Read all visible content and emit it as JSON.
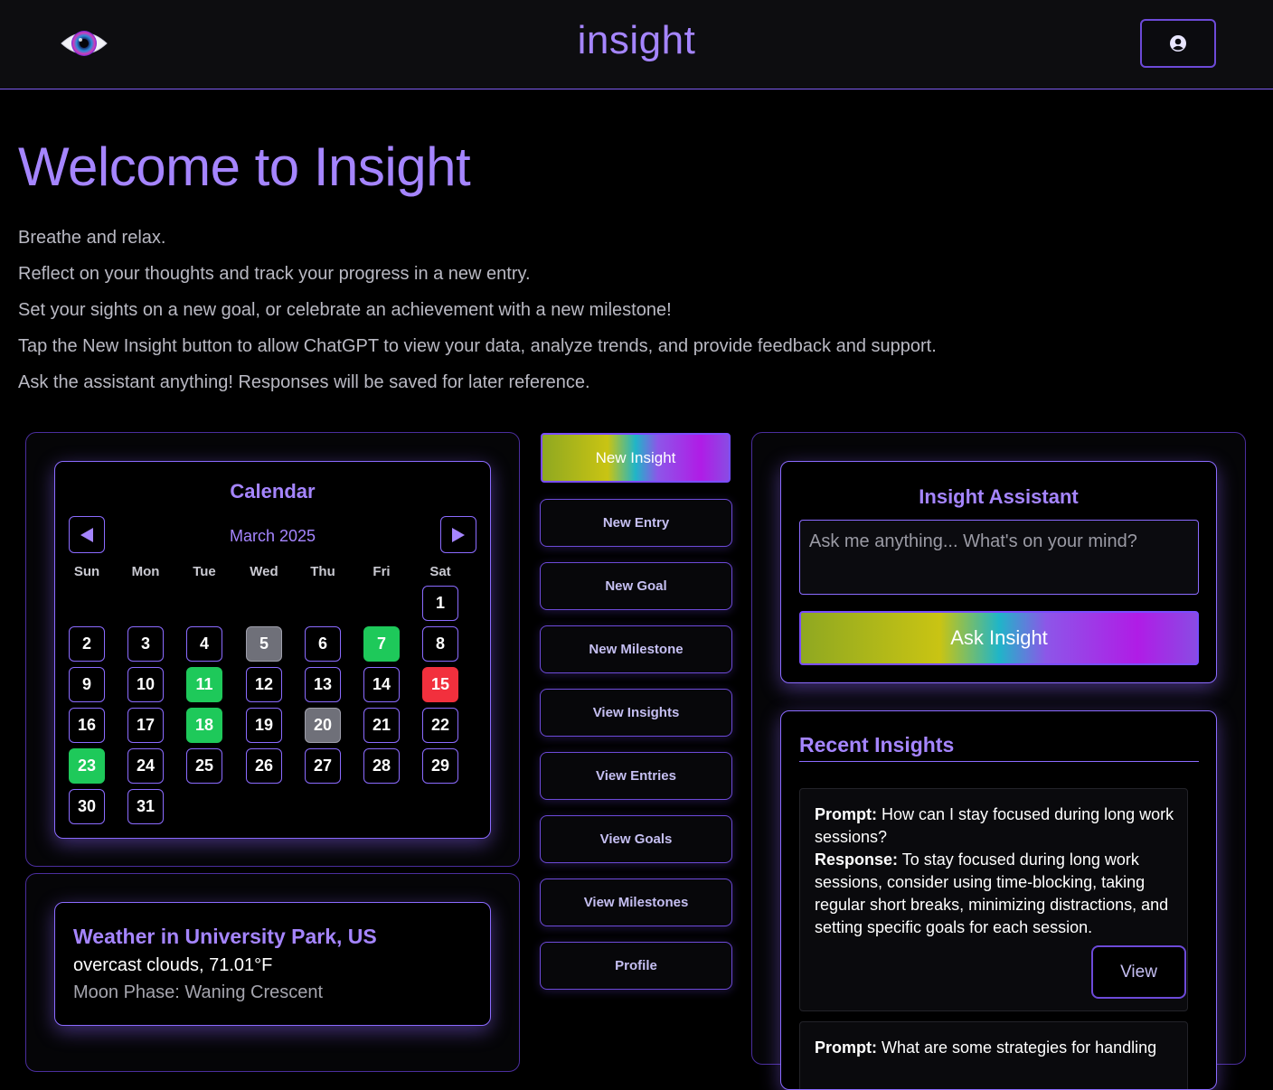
{
  "header": {
    "brand": "insight",
    "logo_icon": "eye-logo-icon",
    "profile_icon": "user-circle-icon"
  },
  "intro": {
    "title": "Welcome to Insight",
    "lines": [
      "Breathe and relax.",
      "Reflect on your thoughts and track your progress in a new entry.",
      "Set your sights on a new goal, or celebrate an achievement with a new milestone!",
      "Tap the New Insight button to allow ChatGPT to view your data, analyze trends, and provide feedback and support.",
      "Ask the assistant anything! Responses will be saved for later reference."
    ]
  },
  "calendar": {
    "title": "Calendar",
    "month": "March 2025",
    "prev_icon": "triangle-left-icon",
    "next_icon": "triangle-right-icon",
    "weekdays": [
      "Sun",
      "Mon",
      "Tue",
      "Wed",
      "Thu",
      "Fri",
      "Sat"
    ],
    "first_weekday_index": 6,
    "days": [
      {
        "n": "1",
        "status": "none"
      },
      {
        "n": "2",
        "status": "none"
      },
      {
        "n": "3",
        "status": "none"
      },
      {
        "n": "4",
        "status": "none"
      },
      {
        "n": "5",
        "status": "gray"
      },
      {
        "n": "6",
        "status": "none"
      },
      {
        "n": "7",
        "status": "green"
      },
      {
        "n": "8",
        "status": "none"
      },
      {
        "n": "9",
        "status": "none"
      },
      {
        "n": "10",
        "status": "none"
      },
      {
        "n": "11",
        "status": "green"
      },
      {
        "n": "12",
        "status": "none"
      },
      {
        "n": "13",
        "status": "none"
      },
      {
        "n": "14",
        "status": "none"
      },
      {
        "n": "15",
        "status": "red"
      },
      {
        "n": "16",
        "status": "none"
      },
      {
        "n": "17",
        "status": "none"
      },
      {
        "n": "18",
        "status": "green"
      },
      {
        "n": "19",
        "status": "none"
      },
      {
        "n": "20",
        "status": "gray"
      },
      {
        "n": "21",
        "status": "none"
      },
      {
        "n": "22",
        "status": "none"
      },
      {
        "n": "23",
        "status": "green"
      },
      {
        "n": "24",
        "status": "none"
      },
      {
        "n": "25",
        "status": "none"
      },
      {
        "n": "26",
        "status": "none"
      },
      {
        "n": "27",
        "status": "none"
      },
      {
        "n": "28",
        "status": "none"
      },
      {
        "n": "29",
        "status": "none"
      },
      {
        "n": "30",
        "status": "none"
      },
      {
        "n": "31",
        "status": "none"
      }
    ],
    "colors": {
      "green": "#1ec95a",
      "red": "#f2303d",
      "gray": "#6f7079",
      "accent": "#a585ff"
    }
  },
  "weather": {
    "title": "Weather in University Park, US",
    "conditions": "overcast clouds, 71.01°F",
    "moon": "Moon Phase: Waning Crescent"
  },
  "actions": {
    "new_insight": "New Insight",
    "buttons": [
      "New Entry",
      "New Goal",
      "New Milestone",
      "View Insights",
      "View Entries",
      "View Goals",
      "View Milestones",
      "Profile"
    ]
  },
  "assistant": {
    "title": "Insight Assistant",
    "placeholder": "Ask me anything... What's on your mind?",
    "button": "Ask Insight"
  },
  "recent": {
    "title": "Recent Insights",
    "prompt_label": "Prompt:",
    "response_label": "Response:",
    "view_label": "View",
    "items": [
      {
        "prompt": "How can I stay focused during long work sessions?",
        "response": "To stay focused during long work sessions, consider using time-blocking, taking regular short breaks, minimizing distractions, and setting specific goals for each session."
      },
      {
        "prompt": "What are some strategies for handling",
        "response": ""
      }
    ]
  }
}
